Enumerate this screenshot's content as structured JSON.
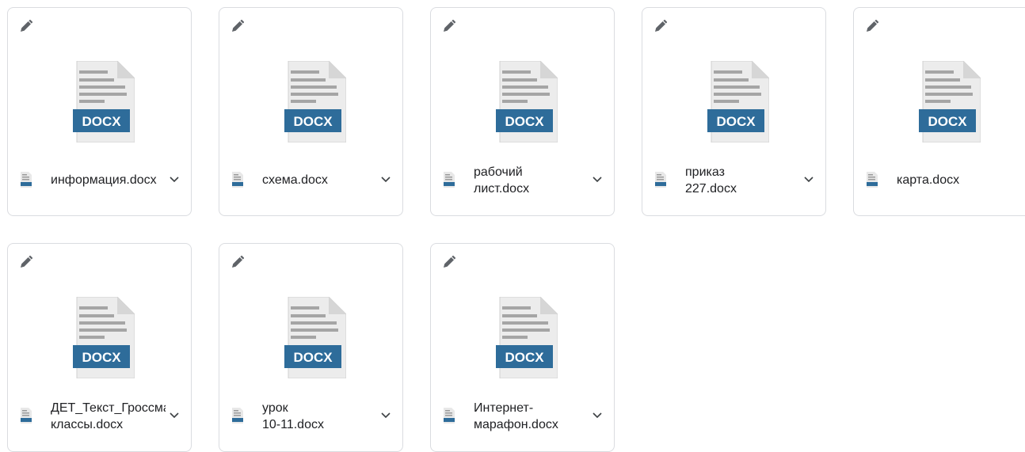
{
  "icons": {
    "edit": "pencil-icon",
    "preview": "docx-document-icon",
    "file_type": "docx-file-icon",
    "menu": "chevron-down-icon"
  },
  "colors": {
    "docx_badge": "#2e6c9a",
    "page": "#ececec",
    "lines": "#a5a5a5",
    "card_border": "#dadce0"
  },
  "badge_text": "DOCX",
  "files": [
    {
      "name": "информация.docx"
    },
    {
      "name": "схема.docx"
    },
    {
      "name": "рабочий\nлист.docx"
    },
    {
      "name": "приказ\n227.docx"
    },
    {
      "name": "карта.docx"
    },
    {
      "name": "ДЕТ_Текст_Гроссмана\nклассы.docx"
    },
    {
      "name": "урок\n10-11.docx"
    },
    {
      "name": "Интернет-\nмарафон.docx"
    }
  ]
}
